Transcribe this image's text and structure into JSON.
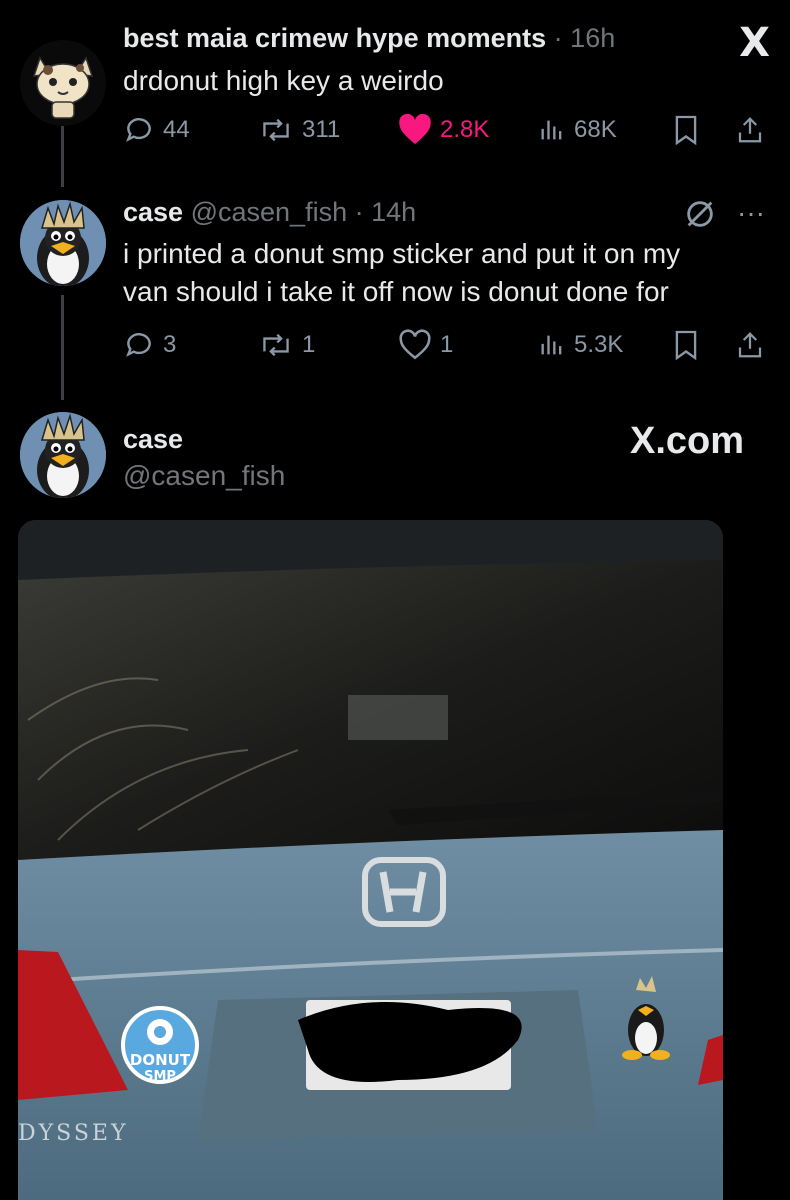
{
  "tweet1": {
    "display_name": "best maia crimew hype moments",
    "time": "16h",
    "text": "drdonut high key a weirdo",
    "replies": "44",
    "reposts": "311",
    "likes": "2.8K",
    "views": "68K",
    "logo": "X"
  },
  "tweet2": {
    "display_name": "case",
    "handle": "@casen_fish",
    "time": "14h",
    "text_line1": "i printed a donut smp sticker and put it on my",
    "text_line2": "van should i take it off now is donut done for",
    "replies": "3",
    "reposts": "1",
    "likes": "1",
    "views": "5.3K"
  },
  "embed": {
    "display_name": "case",
    "handle": "@casen_fish",
    "site": "X.com",
    "photo": {
      "sticker_text_1": "DONUT",
      "sticker_text_2": "SMP",
      "car_badge": "DYSSEY"
    }
  },
  "colors": {
    "background": "#000000",
    "muted": "#71767b",
    "like": "#f91880",
    "van": "#5d7a8f"
  }
}
